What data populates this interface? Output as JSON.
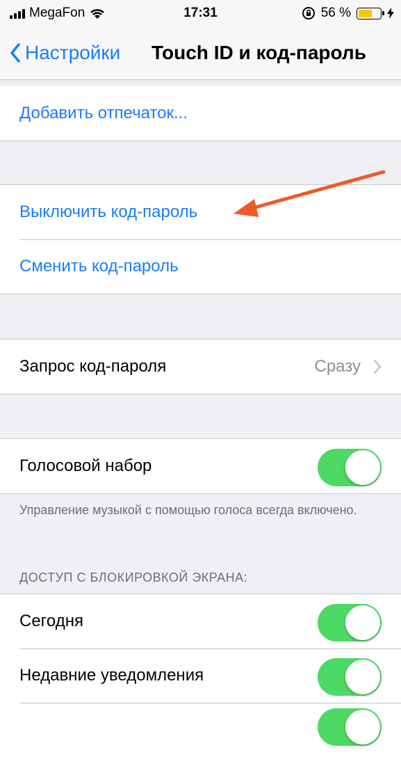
{
  "status_bar": {
    "carrier": "MegaFon",
    "time": "17:31",
    "battery_percent": "56 %",
    "battery_level": 0.56
  },
  "nav": {
    "back_label": "Настройки",
    "title": "Touch ID и код-пароль"
  },
  "fingerprints": {
    "add_label": "Добавить отпечаток..."
  },
  "passcode": {
    "turn_off_label": "Выключить код-пароль",
    "change_label": "Сменить код-пароль"
  },
  "require": {
    "label": "Запрос код-пароля",
    "value": "Сразу"
  },
  "voice_dial": {
    "label": "Голосовой набор",
    "enabled": true,
    "note": "Управление музыкой с помощью голоса всегда включено."
  },
  "lock_screen": {
    "header": "ДОСТУП С БЛОКИРОВКОЙ ЭКРАНА:",
    "items": [
      {
        "label": "Сегодня",
        "enabled": true
      },
      {
        "label": "Недавние уведомления",
        "enabled": true
      }
    ]
  },
  "colors": {
    "accent": "#1a7cf5",
    "toggle_on": "#4cd964",
    "annotation_arrow": "#f05a28"
  }
}
